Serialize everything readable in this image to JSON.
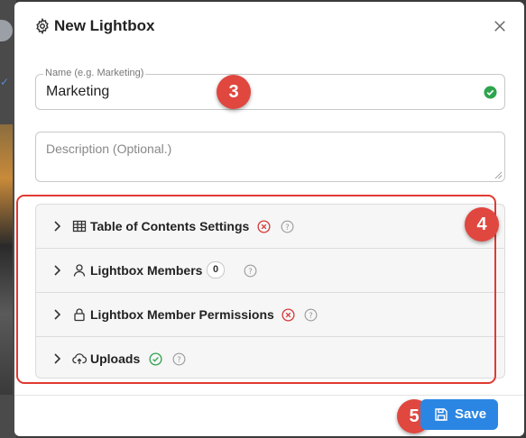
{
  "modal": {
    "title": "New Lightbox",
    "close_icon": "close-icon",
    "title_icon": "gear-icon"
  },
  "form": {
    "name": {
      "label": "Name (e.g. Marketing)",
      "value": "Marketing",
      "status_icon": "check-circle-icon",
      "status_color": "#2ea44f"
    },
    "description": {
      "placeholder": "Description (Optional.)"
    }
  },
  "sections": [
    {
      "label": "Table of Contents Settings",
      "icon": "table-icon",
      "status": "error",
      "status_icon": "x-circle-icon"
    },
    {
      "label": "Lightbox Members",
      "icon": "user-icon",
      "count": "0"
    },
    {
      "label": "Lightbox Member Permissions",
      "icon": "lock-icon",
      "status": "error",
      "status_icon": "x-circle-icon"
    },
    {
      "label": "Uploads",
      "icon": "cloud-upload-icon",
      "status": "ok",
      "status_icon": "check-circle-icon"
    }
  ],
  "footer": {
    "save_label": "Save",
    "save_icon": "floppy-disk-icon"
  },
  "annotations": {
    "step_name": "3",
    "step_sections": "4",
    "step_save": "5"
  },
  "colors": {
    "accent": "#2b86e3",
    "error": "#d63a3a",
    "success": "#2ea44f",
    "annotation": "#e0473f"
  }
}
